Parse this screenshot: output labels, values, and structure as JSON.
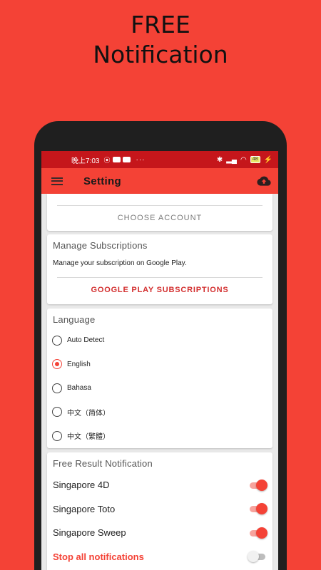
{
  "promo": {
    "line1": "FREE",
    "line2": "Notification"
  },
  "status_bar": {
    "time": "晚上7:03",
    "left_icons": [
      "notification-icon",
      "youtube-icon",
      "youtube-icon"
    ],
    "more": "···",
    "right_icons": [
      "bluetooth-icon",
      "signal-icon",
      "wifi-icon"
    ],
    "battery": "48"
  },
  "app_bar": {
    "title": "Setting",
    "menu_icon": "hamburger-menu-icon",
    "action_icon": "cloud-upload-icon"
  },
  "account_card": {
    "button": "CHOOSE ACCOUNT"
  },
  "subscriptions_card": {
    "title": "Manage Subscriptions",
    "description": "Manage your subscription on Google Play.",
    "button": "GOOGLE PLAY SUBSCRIPTIONS"
  },
  "language_card": {
    "title": "Language",
    "options": [
      {
        "label": "Auto Detect",
        "selected": false
      },
      {
        "label": "English",
        "selected": true
      },
      {
        "label": "Bahasa",
        "selected": false
      },
      {
        "label": "中文（简体）",
        "selected": false
      },
      {
        "label": "中文（繁體）",
        "selected": false
      }
    ]
  },
  "notification_card": {
    "title": "Free Result Notification",
    "items": [
      {
        "label": "Singapore 4D",
        "on": true
      },
      {
        "label": "Singapore Toto",
        "on": true
      },
      {
        "label": "Singapore Sweep",
        "on": true
      }
    ],
    "stop_all": {
      "label": "Stop all notifications",
      "on": false
    }
  },
  "colors": {
    "background": "#f44236",
    "status_bar": "#c5161b",
    "accent": "#f44236",
    "link": "#d32f2f"
  }
}
